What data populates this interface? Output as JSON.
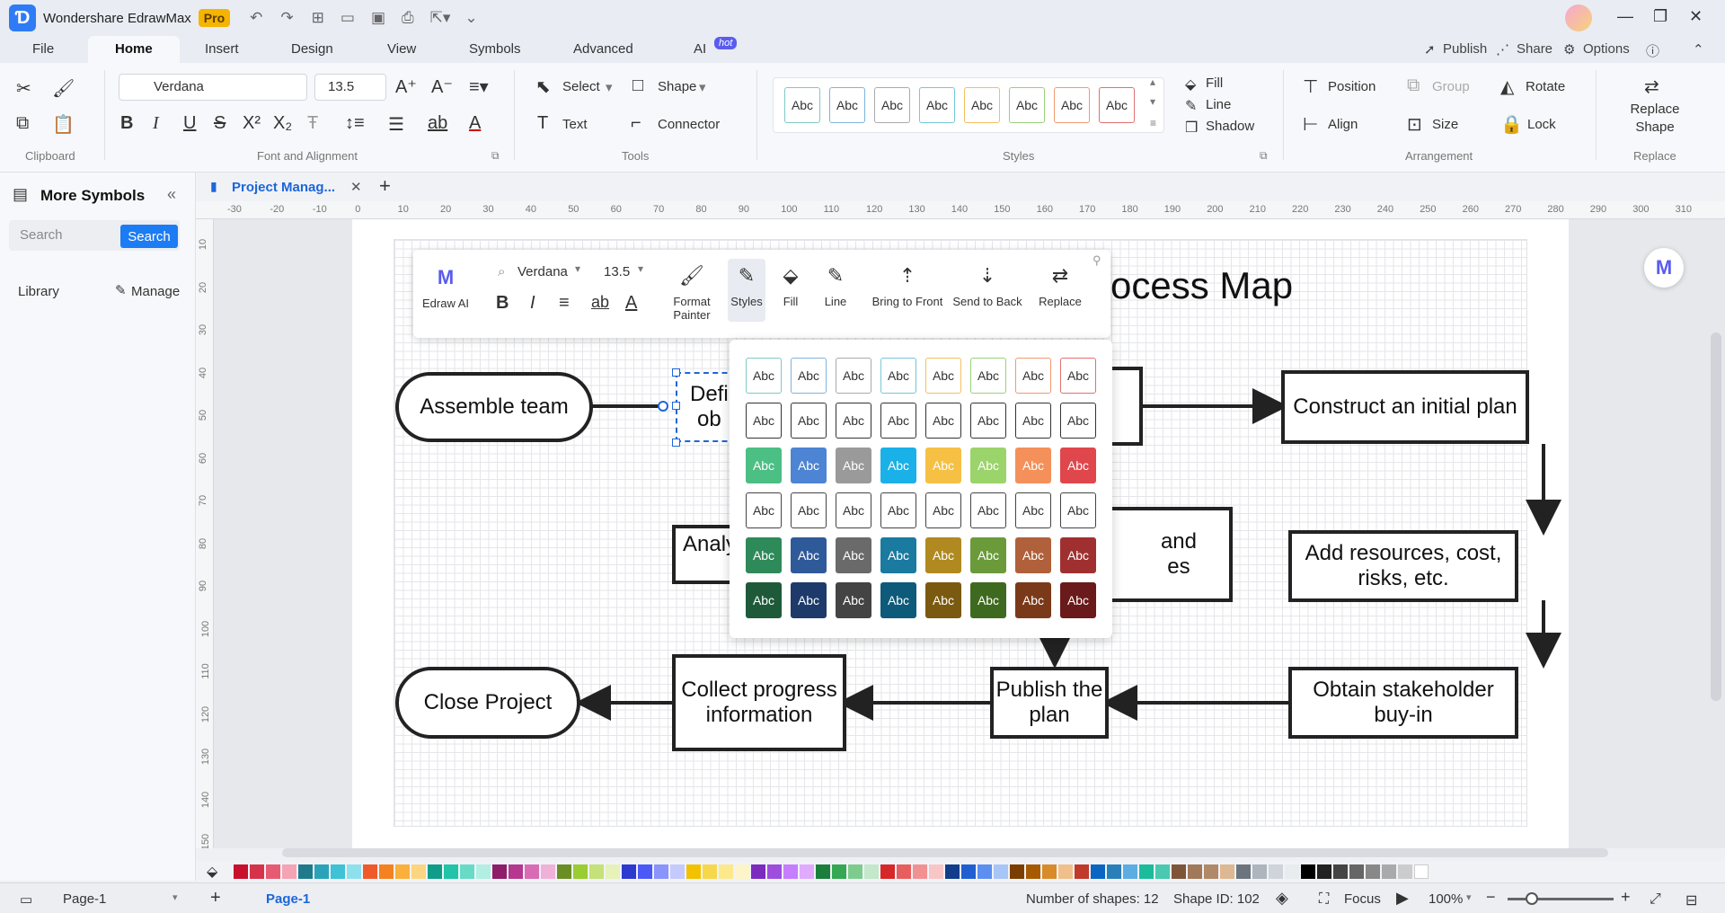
{
  "app": {
    "title": "Wondershare EdrawMax",
    "badge": "Pro"
  },
  "menu": {
    "tabs": [
      "File",
      "Home",
      "Insert",
      "Design",
      "View",
      "Symbols",
      "Advanced",
      "AI"
    ],
    "active": "Home",
    "ai_badge": "hot",
    "right": {
      "publish": "Publish",
      "share": "Share",
      "options": "Options"
    }
  },
  "ribbon": {
    "font": {
      "family": "Verdana",
      "size": "13.5"
    },
    "select_label": "Select",
    "shape_label": "Shape",
    "text_label": "Text",
    "connector_label": "Connector",
    "fill_label": "Fill",
    "line_label": "Line",
    "shadow_label": "Shadow",
    "position_label": "Position",
    "group_label": "Group",
    "rotate_label": "Rotate",
    "align_label": "Align",
    "size_label": "Size",
    "lock_label": "Lock",
    "replace_shape_label": "Replace Shape",
    "groups": [
      "Clipboard",
      "Font and Alignment",
      "Tools",
      "Styles",
      "Arrangement",
      "Replace"
    ],
    "style_swatch_text": "Abc",
    "style_colors": [
      "#7ecac2",
      "#7eb4dc",
      "#aaaaaa",
      "#74c8d8",
      "#f2c060",
      "#9ad07a",
      "#f29a70",
      "#e07070"
    ]
  },
  "left_panel": {
    "title": "More Symbols",
    "search_placeholder": "Search",
    "search_button": "Search",
    "library": "Library",
    "manage": "Manage"
  },
  "doc_tab": {
    "label": "Project Manag..."
  },
  "rulers": {
    "h": [
      "-30",
      "-20",
      "-10",
      "0",
      "10",
      "20",
      "30",
      "40",
      "50",
      "60",
      "70",
      "80",
      "90",
      "100",
      "110",
      "120",
      "130",
      "140",
      "150",
      "160",
      "170",
      "180",
      "190",
      "200",
      "210",
      "220",
      "230",
      "240",
      "250",
      "260",
      "270",
      "280",
      "290",
      "300",
      "310"
    ],
    "v": [
      "10",
      "20",
      "30",
      "40",
      "50",
      "60",
      "70",
      "80",
      "90",
      "100",
      "110",
      "120",
      "130",
      "140",
      "150"
    ]
  },
  "diagram": {
    "title": "rocess Map",
    "nodes": {
      "assemble": "Assemble team",
      "define": "Defi\nob",
      "construct": "Construct an initial plan",
      "analyze": "Analy",
      "mid_right": "and\nes",
      "resources": "Add resources, cost, risks, etc.",
      "close": "Close Project",
      "collect": "Collect progress information",
      "publish": "Publish the plan",
      "obtain": "Obtain stakeholder buy-in"
    }
  },
  "float_toolbar": {
    "font": "Verdana",
    "size": "13.5",
    "edraw_ai": "Edraw AI",
    "format_painter": "Format Painter",
    "styles": "Styles",
    "fill": "Fill",
    "line": "Line",
    "bring_front": "Bring to Front",
    "send_back": "Send to Back",
    "replace": "Replace"
  },
  "style_popup": {
    "swatch_text": "Abc",
    "rows": [
      {
        "fill": "#ffffff",
        "text": "#333333",
        "borders": [
          "#7ecac2",
          "#7eb4dc",
          "#aaaaaa",
          "#74c8d8",
          "#f2c060",
          "#9ad07a",
          "#f29a70",
          "#e07070"
        ]
      },
      {
        "fill": "#ffffff",
        "text": "#333333",
        "borders": [
          "#333333",
          "#333333",
          "#333333",
          "#333333",
          "#333333",
          "#333333",
          "#333333",
          "#333333"
        ]
      },
      {
        "fill": "colors",
        "text": "#ffffff",
        "fills": [
          "#4cbf84",
          "#4d84d4",
          "#9a9a9a",
          "#1ab0e8",
          "#f5c044",
          "#9ad46a",
          "#f4905a",
          "#e0474c"
        ]
      },
      {
        "fill": "#ffffff",
        "text": "#333333",
        "borders": [
          "#444444",
          "#444444",
          "#444444",
          "#444444",
          "#444444",
          "#444444",
          "#444444",
          "#444444"
        ]
      },
      {
        "fill": "colors",
        "text": "#ffffff",
        "fills": [
          "#2f8a5a",
          "#2f5a9a",
          "#6a6a6a",
          "#1a7aa0",
          "#b08a20",
          "#6a9a3a",
          "#b0603a",
          "#a03030"
        ]
      },
      {
        "fill": "colors",
        "text": "#ffffff",
        "fills": [
          "#1e5a3a",
          "#1e3a6a",
          "#444444",
          "#0e5a7a",
          "#7a5a10",
          "#3e6a20",
          "#7a3a1a",
          "#6a1a1a"
        ]
      }
    ]
  },
  "palette": [
    "#c8102e",
    "#d6334a",
    "#e85a71",
    "#f4a4b4",
    "#1f7a8c",
    "#2aa3b8",
    "#3fc1d6",
    "#8ee0ec",
    "#f05a28",
    "#f58220",
    "#fbb03b",
    "#fcd581",
    "#0f9d8a",
    "#21c4a8",
    "#67dbc6",
    "#b1efe3",
    "#8e1d6a",
    "#b6378f",
    "#d96bb4",
    "#f0b1d8",
    "#6a8e23",
    "#9acd32",
    "#c5e17a",
    "#e6f2b8",
    "#2d3ad0",
    "#4b59f7",
    "#8a94fa",
    "#c5cafd",
    "#f2c200",
    "#f7d84b",
    "#fbe98c",
    "#fdf5c9",
    "#7b2cbf",
    "#9d4edd",
    "#c77dff",
    "#e0aaff",
    "#1b7f3b",
    "#34a853",
    "#7dcc8e",
    "#c3e8cb",
    "#d62828",
    "#e85d5d",
    "#f29191",
    "#f8c6c6",
    "#123d8a",
    "#1f5fd1",
    "#5b8ff0",
    "#a8c5f8",
    "#7a3e00",
    "#a85a00",
    "#d98a2b",
    "#f0c08a",
    "#c0392b",
    "#0a66c2",
    "#2980b9",
    "#5dade2",
    "#1abc9c",
    "#48c9b0",
    "#7f5539",
    "#a0785a",
    "#b08968",
    "#ddb892",
    "#6c757d",
    "#adb5bd",
    "#ced4da",
    "#e9ecef",
    "#000000",
    "#222222",
    "#444444",
    "#666666",
    "#888888",
    "#aaaaaa",
    "#cccccc",
    "#ffffff"
  ],
  "status": {
    "page_selector": "Page-1",
    "page_tab": "Page-1",
    "shapes": "Number of shapes: 12",
    "shape_id": "Shape ID: 102",
    "focus": "Focus",
    "zoom": "100%"
  }
}
